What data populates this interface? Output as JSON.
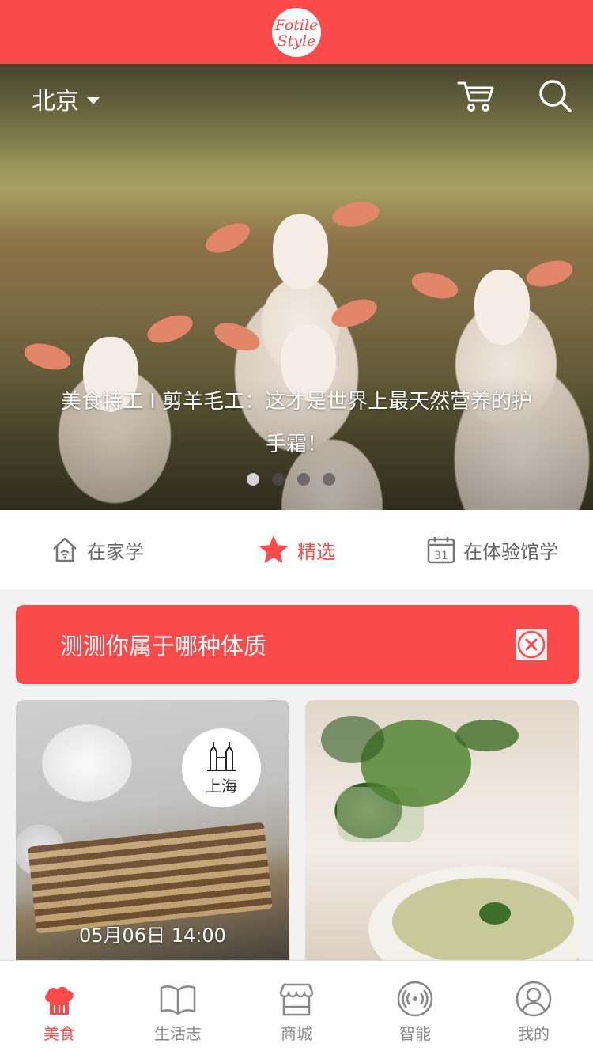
{
  "brand": {
    "logo_line1": "Fotile",
    "logo_line2": "Style"
  },
  "hero": {
    "city": "北京",
    "caption": "美食特工 I 剪羊毛工：这才是世界上最天然营养的护手霜！",
    "slide_count": 4,
    "active_slide": 1
  },
  "tabs": [
    {
      "label": "在家学",
      "icon": "home-wifi-icon"
    },
    {
      "label": "精选",
      "icon": "star-icon",
      "active": true
    },
    {
      "label": "在体验馆学",
      "icon": "calendar-icon",
      "calendar_day": "31"
    }
  ],
  "quiz": {
    "text": "测测你属于哪种体质"
  },
  "cards": [
    {
      "badge_city": "上海",
      "badge_icon": "city-towers-icon",
      "time": "05月06日 14:00"
    },
    {}
  ],
  "bottom_nav": [
    {
      "label": "美食",
      "icon": "chef-hat-icon",
      "active": true
    },
    {
      "label": "生活志",
      "icon": "book-icon"
    },
    {
      "label": "商城",
      "icon": "shop-icon"
    },
    {
      "label": "智能",
      "icon": "smart-device-icon"
    },
    {
      "label": "我的",
      "icon": "user-icon"
    }
  ],
  "colors": {
    "accent": "#fb4a4a"
  }
}
